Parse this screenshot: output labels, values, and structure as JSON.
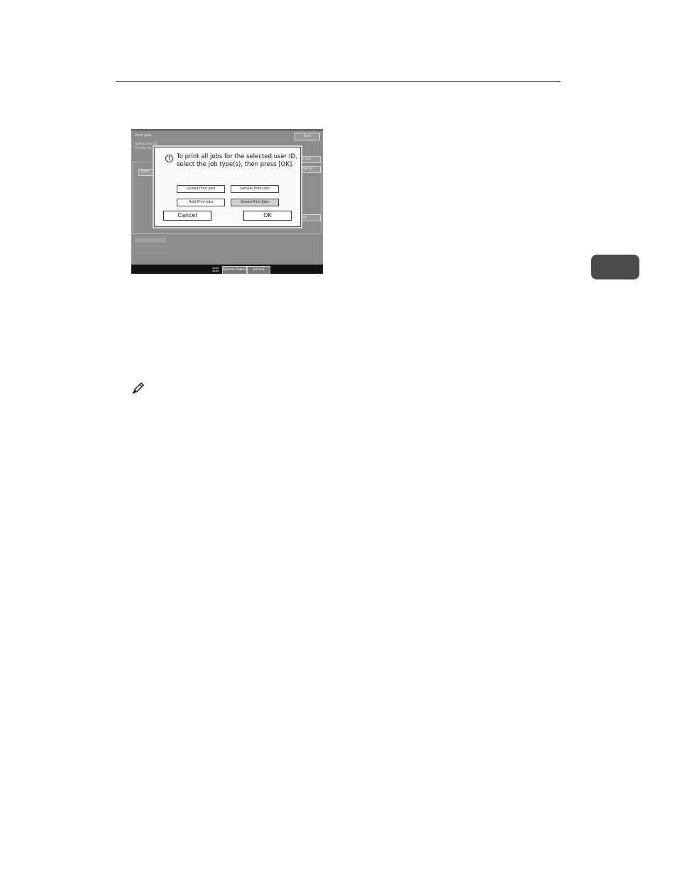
{
  "screen": {
    "title": "Print Jobs",
    "exit_label": "Exit",
    "select_line1": "Select User ID.",
    "select_line2": "All jobs for",
    "right_btn1": "m List",
    "right_btn2": "User ID",
    "right_btn3": "Jobs",
    "left_btn": "0000",
    "status_btn": "System Status",
    "joblist_btn": "Job List"
  },
  "dialog": {
    "line1": "To print all jobs for the selected user ID,",
    "line2": "select the job type(s), then press [OK].",
    "locked": "Locked Print Jobs",
    "sample": "Sample Print Jobs",
    "hold": "Hold Print Jobs",
    "stored": "Stored Print Jobs",
    "cancel": "Cancel",
    "ok": "OK"
  }
}
